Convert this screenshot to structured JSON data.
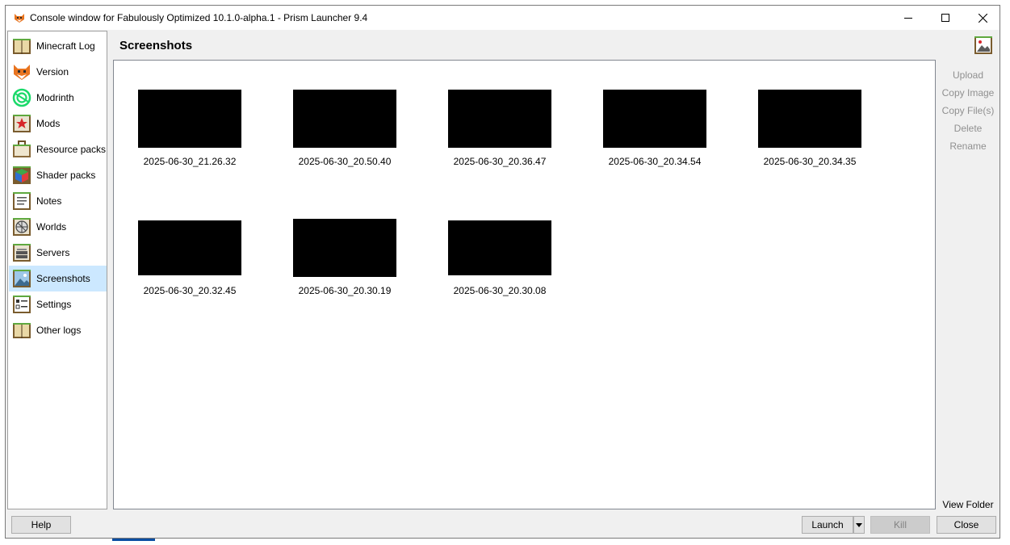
{
  "window": {
    "title": "Console window for Fabulously Optimized 10.1.0-alpha.1 - Prism Launcher 9.4",
    "app_icon": "fox-icon",
    "controls": [
      "minimize-icon",
      "maximize-icon",
      "close-icon"
    ]
  },
  "sidebar": {
    "items": [
      {
        "label": "Minecraft Log",
        "icon": "book-icon"
      },
      {
        "label": "Version",
        "icon": "fox-icon"
      },
      {
        "label": "Modrinth",
        "icon": "modrinth-icon"
      },
      {
        "label": "Mods",
        "icon": "star-icon"
      },
      {
        "label": "Resource packs",
        "icon": "resource-pack-icon"
      },
      {
        "label": "Shader packs",
        "icon": "shader-cube-icon"
      },
      {
        "label": "Notes",
        "icon": "notes-icon"
      },
      {
        "label": "Worlds",
        "icon": "world-icon"
      },
      {
        "label": "Servers",
        "icon": "server-icon"
      },
      {
        "label": "Screenshots",
        "icon": "screenshot-icon",
        "selected": true
      },
      {
        "label": "Settings",
        "icon": "settings-icon"
      },
      {
        "label": "Other logs",
        "icon": "book-icon"
      }
    ]
  },
  "page": {
    "title": "Screenshots",
    "icon": "screenshot-icon"
  },
  "screenshots": [
    {
      "name": "2025-06-30_21.26.32"
    },
    {
      "name": "2025-06-30_20.50.40"
    },
    {
      "name": "2025-06-30_20.36.47"
    },
    {
      "name": "2025-06-30_20.34.54"
    },
    {
      "name": "2025-06-30_20.34.35"
    },
    {
      "name": "2025-06-30_20.32.45"
    },
    {
      "name": "2025-06-30_20.30.19"
    },
    {
      "name": "2025-06-30_20.30.08"
    }
  ],
  "actions": {
    "upload": "Upload",
    "copy_image": "Copy Image",
    "copy_files": "Copy File(s)",
    "delete": "Delete",
    "rename": "Rename",
    "view_folder": "View Folder"
  },
  "footer": {
    "help": "Help",
    "launch": "Launch",
    "kill": "Kill",
    "close": "Close"
  },
  "colors": {
    "selection": "#cce8ff",
    "disabled_text": "#909090",
    "accent_green": "#5fa93f"
  }
}
